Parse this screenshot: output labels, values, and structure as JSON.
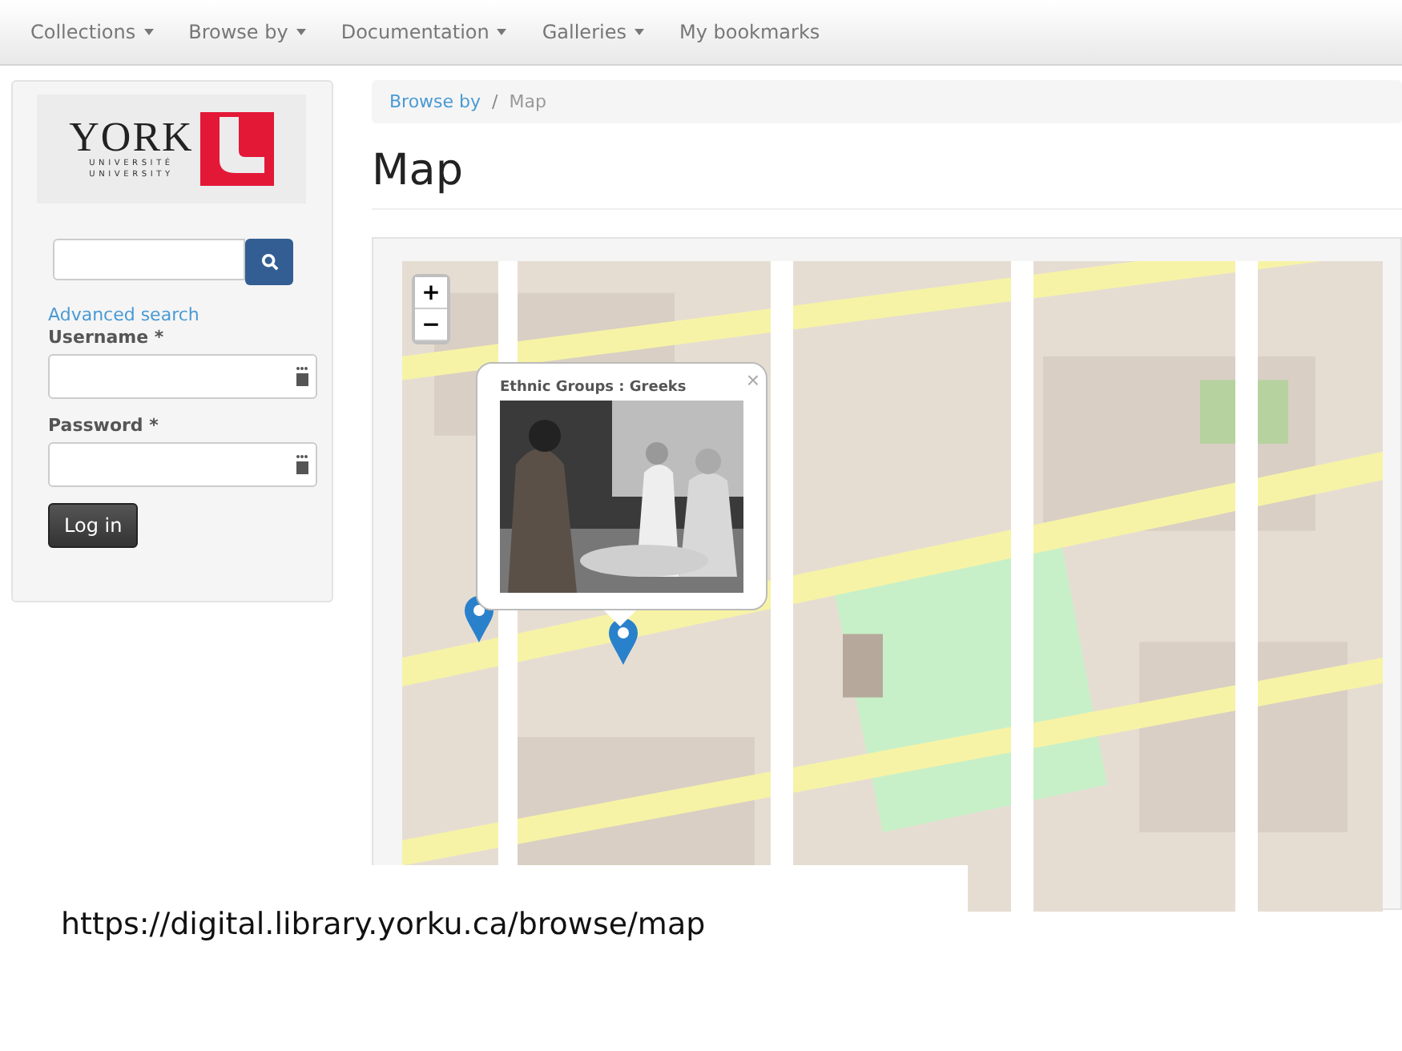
{
  "nav": [
    {
      "label": "Collections",
      "dropdown": true
    },
    {
      "label": "Browse by",
      "dropdown": true
    },
    {
      "label": "Documentation",
      "dropdown": true
    },
    {
      "label": "Galleries",
      "dropdown": true
    },
    {
      "label": "My bookmarks",
      "dropdown": false
    }
  ],
  "logo": {
    "wordmark": "YORK",
    "line1": "UNIVERSITÉ",
    "line2": "UNIVERSITY"
  },
  "advanced_search": "Advanced search",
  "fields": [
    {
      "label": "Username *"
    },
    {
      "label": "Password *"
    }
  ],
  "login_button": "Log in",
  "breadcrumb_separator": "/",
  "breadcrumb": [
    {
      "label": "Browse by",
      "link": true
    },
    {
      "label": "Map",
      "link": false
    }
  ],
  "heading": "Map",
  "map": {
    "zoom_in": "+",
    "zoom_out": "−",
    "popup": {
      "title": "Ethnic Groups : Greeks",
      "close": "×"
    }
  },
  "caption": "https://digital.library.yorku.ca/browse/map"
}
